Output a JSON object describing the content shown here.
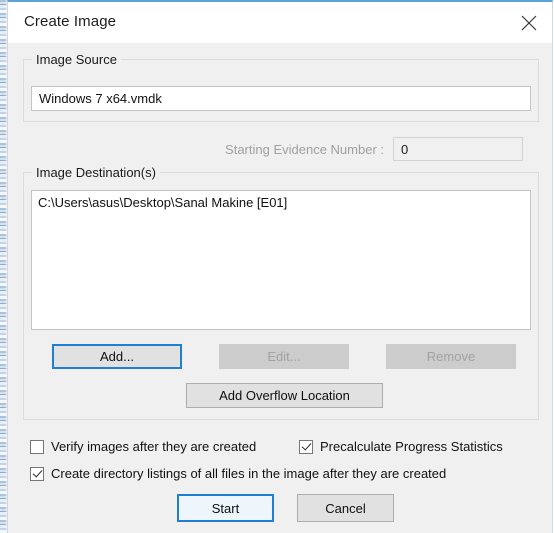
{
  "window": {
    "title": "Create Image",
    "close_icon": "close-icon",
    "accent_color": "#5ba3d9",
    "background_color": "#f0f0f0",
    "titlebar_color": "#ffffff"
  },
  "image_source": {
    "group_label": "Image Source",
    "path_value": "Windows 7 x64.vmdk",
    "evidence_number_label": "Starting Evidence Number :",
    "evidence_number_value": "0",
    "evidence_number_disabled": true
  },
  "image_destinations": {
    "group_label": "Image Destination(s)",
    "items": [
      "C:\\Users\\asus\\Desktop\\Sanal Makine [E01]"
    ],
    "buttons": {
      "add": "Add...",
      "edit": "Edit...",
      "remove": "Remove",
      "add_overflow": "Add Overflow Location"
    },
    "button_states": {
      "add": "focused",
      "edit": "disabled",
      "remove": "disabled",
      "add_overflow": "normal"
    }
  },
  "options": {
    "verify_images": {
      "label": "Verify images after they are created",
      "checked": false
    },
    "precalculate_stats": {
      "label": "Precalculate Progress Statistics",
      "checked": true
    },
    "create_dir_listings": {
      "label": "Create directory listings of all files in the image after they are created",
      "checked": true
    }
  },
  "footer": {
    "start_label": "Start",
    "cancel_label": "Cancel"
  }
}
